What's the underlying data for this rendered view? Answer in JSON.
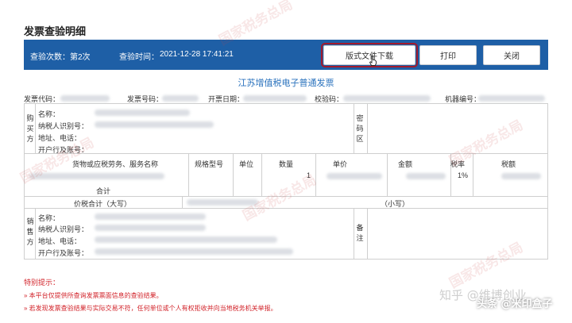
{
  "page": {
    "title": "发票查验明细"
  },
  "header_bar": {
    "check_count_label": "查验次数：第2次",
    "check_time_label": "查验时间：",
    "check_time_value": "2021-12-28 17:41:21",
    "buttons": {
      "download": "版式文件下载",
      "print": "打印",
      "close": "关闭"
    }
  },
  "invoice": {
    "title": "江苏增值税电子普通发票",
    "invoice_code_label": "发票代码：",
    "invoice_number_label": "发票号码：",
    "issue_date_label": "开票日期：",
    "check_code_label": "校验码：",
    "machine_number_label": "机器编号：",
    "buyer": {
      "section": "购买方",
      "name_label": "名称：",
      "tax_id_label": "纳税人识别号：",
      "address_label": "地址、电话：",
      "bank_label": "开户行及账号：",
      "cipher_area": "密码区"
    },
    "items": {
      "headers": {
        "name": "货物或应税劳务、服务名称",
        "spec": "规格型号",
        "unit": "单位",
        "quantity": "数量",
        "price": "单价",
        "amount": "金额",
        "tax_rate": "税率",
        "tax": "税额"
      },
      "row": {
        "quantity": "1",
        "tax_rate": "1%"
      },
      "subtotal_label": "合计"
    },
    "total_label": "价税合计（大写）",
    "total_small_label": "（小写）",
    "seller": {
      "section": "销售方",
      "name_label": "名称：",
      "tax_id_label": "纳税人识别号：",
      "address_label": "地址、电话：",
      "bank_label": "开户行及账号：",
      "remark": "备注"
    }
  },
  "notes": {
    "title": "特别提示：",
    "items": [
      "»  本平台仅提供所查询发票票面信息的查验结果。",
      "»  若发现发票查验结果与实际交易不符，任何单位或个人有权拒收并向当地税务机关举报。"
    ]
  },
  "overlay": {
    "watermark_text": "国家税务总局",
    "zhihu_text": "知乎 @维博创业",
    "toutiao_text": "头条 @米印盒子"
  }
}
